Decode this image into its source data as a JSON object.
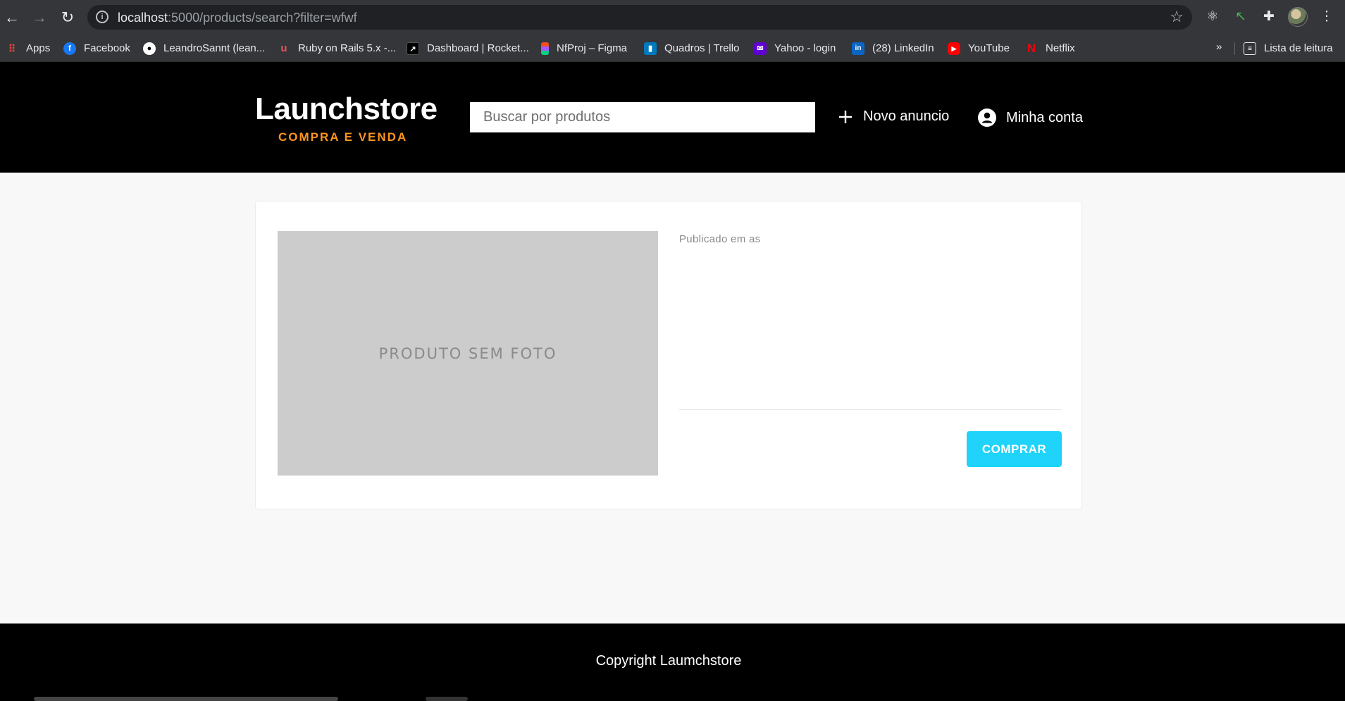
{
  "browser": {
    "url_host": "localhost",
    "url_rest": ":5000/products/search?filter=wfwf",
    "bookmarks": [
      {
        "label": "Apps",
        "icon": "apps-grid-icon",
        "color": "#e8453c"
      },
      {
        "label": "Facebook",
        "icon": "facebook-icon",
        "color": "#1877f2"
      },
      {
        "label": "LeandroSannt (lean...",
        "icon": "github-icon",
        "color": "#ffffff"
      },
      {
        "label": "Ruby on Rails 5.x -...",
        "icon": "udemy-icon",
        "color": "#ec5252"
      },
      {
        "label": "Dashboard | Rocket...",
        "icon": "rocketseat-icon",
        "color": "#000000"
      },
      {
        "label": "NfProj – Figma",
        "icon": "figma-icon",
        "color": "#a259ff"
      },
      {
        "label": "Quadros | Trello",
        "icon": "trello-icon",
        "color": "#0079bf"
      },
      {
        "label": "Yahoo - login",
        "icon": "yahoo-mail-icon",
        "color": "#6001d2"
      },
      {
        "label": "(28) LinkedIn",
        "icon": "linkedin-icon",
        "color": "#0a66c2"
      },
      {
        "label": "YouTube",
        "icon": "youtube-icon",
        "color": "#ff0000"
      },
      {
        "label": "Netflix",
        "icon": "netflix-icon",
        "color": "#e50914"
      }
    ],
    "more": "»",
    "reading_list": "Lista de leitura"
  },
  "header": {
    "logo_title": "Launchstore",
    "logo_subtitle": "COMPRA E VENDA",
    "search_placeholder": "Buscar por produtos",
    "new_ad": "Novo anuncio",
    "my_account": "Minha conta"
  },
  "product": {
    "no_photo": "PRODUTO SEM FOTO",
    "published": "Publicado em as",
    "buy_label": "COMPRAR"
  },
  "footer": {
    "copyright": "Copyright Laumchstore"
  },
  "colors": {
    "accent": "#fd951f",
    "buy_button": "#1fd3fb",
    "header_bg": "#000000"
  }
}
